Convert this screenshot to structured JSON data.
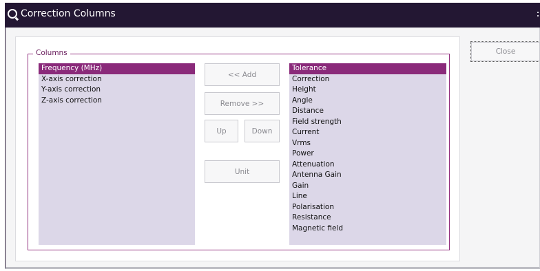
{
  "window": {
    "title": "Correction Columns",
    "icon": "q-logo-icon"
  },
  "columns_group": {
    "label": "Columns"
  },
  "selected_columns": [
    "Frequency (MHz)",
    "X-axis correction",
    "Y-axis correction",
    "Z-axis correction"
  ],
  "selected_columns_highlight": "Frequency (MHz)",
  "available_columns": [
    "Tolerance",
    "Correction",
    "Height",
    "Angle",
    "Distance",
    "Field strength",
    "Current",
    "Vrms",
    "Power",
    "Attenuation",
    "Antenna Gain",
    "Gain",
    "Line",
    "Polarisation",
    "Resistance",
    "Magnetic field"
  ],
  "available_columns_highlight": "Tolerance",
  "buttons": {
    "add": "<< Add",
    "remove": "Remove >>",
    "up": "Up",
    "down": "Down",
    "unit": "Unit",
    "close": "Close"
  },
  "colors": {
    "titlebar": "#231733",
    "accent": "#8a2a7a",
    "list_background": "#dcd7e8"
  }
}
